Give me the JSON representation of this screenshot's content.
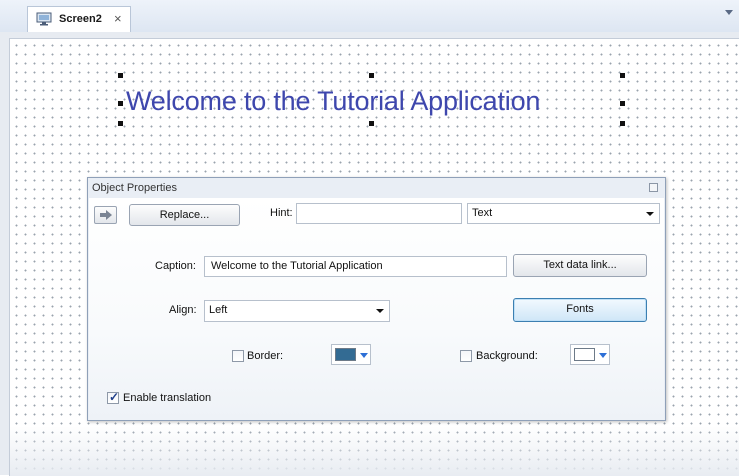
{
  "tab": {
    "label": "Screen2",
    "close_glyph": "×",
    "icon": "monitor-icon"
  },
  "canvas": {
    "welcome_text": "Welcome to the Tutorial Application",
    "welcome_color": "#3e47ad"
  },
  "dialog": {
    "title": "Object Properties",
    "close_glyph": "⊠",
    "replace_label": "Replace...",
    "hint_label": "Hint:",
    "hint_value": "",
    "type_value": "Text",
    "caption_label": "Caption:",
    "caption_value": "Welcome to the Tutorial Application",
    "text_data_link_label": "Text data link...",
    "align_label": "Align:",
    "align_value": "Left",
    "fonts_label": "Fonts",
    "border_label": "Border:",
    "border_checked": false,
    "border_color": "#336b93",
    "background_label": "Background:",
    "background_checked": false,
    "background_color": "#ffffff",
    "enable_translation_label": "Enable translation",
    "enable_translation_checked": true
  }
}
